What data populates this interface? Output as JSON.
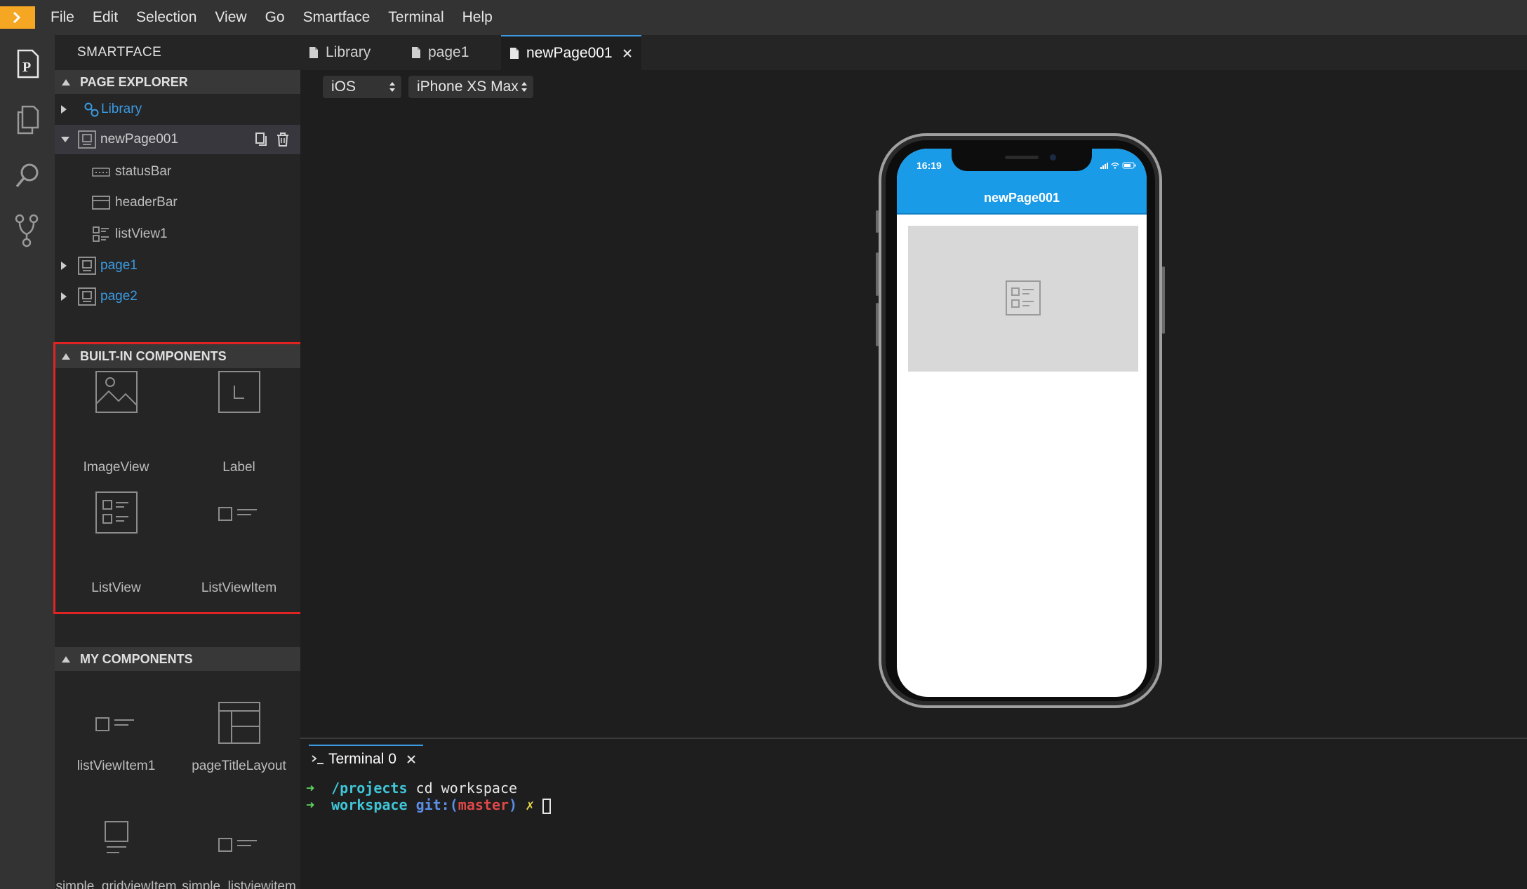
{
  "menu": {
    "items": [
      "File",
      "Edit",
      "Selection",
      "View",
      "Go",
      "Smartface",
      "Terminal",
      "Help"
    ]
  },
  "activity_icons": [
    "page-icon",
    "files-icon",
    "search-icon",
    "source-control-icon"
  ],
  "sidebar": {
    "title": "SMARTFACE",
    "page_explorer": {
      "header": "PAGE EXPLORER",
      "items": [
        {
          "label": "Library"
        },
        {
          "label": "newPage001"
        },
        {
          "label": "statusBar"
        },
        {
          "label": "headerBar"
        },
        {
          "label": "listView1"
        },
        {
          "label": "page1"
        },
        {
          "label": "page2"
        }
      ]
    },
    "builtin": {
      "header": "BUILT-IN COMPONENTS",
      "items": [
        {
          "label": "ImageView"
        },
        {
          "label": "Label"
        },
        {
          "label": "ListView"
        },
        {
          "label": "ListViewItem"
        }
      ]
    },
    "my_components": {
      "header": "MY COMPONENTS",
      "items": [
        {
          "label": "listViewItem1"
        },
        {
          "label": "pageTitleLayout"
        },
        {
          "label": "simple_gridviewItem"
        },
        {
          "label": "simple_listviewitem"
        }
      ]
    }
  },
  "tabs": [
    {
      "label": "Library"
    },
    {
      "label": "page1"
    },
    {
      "label": "newPage001"
    }
  ],
  "toolbar": {
    "os_select": "iOS",
    "device_select": "iPhone XS Max"
  },
  "preview": {
    "time": "16:19",
    "header_title": "newPage001"
  },
  "terminal": {
    "tab_label": "Terminal 0",
    "prompt_symbol": "➜",
    "line1": {
      "path": "/projects",
      "cmd": "cd workspace"
    },
    "line2": {
      "dir": "workspace",
      "git": "git:(",
      "branch": "master",
      "close": ")",
      "dirty": "✗"
    }
  },
  "colors": {
    "accent": "#3b9ae1",
    "highlight_box": "#e02424",
    "app_header": "#1a9be8",
    "logo": "#f5a623"
  }
}
